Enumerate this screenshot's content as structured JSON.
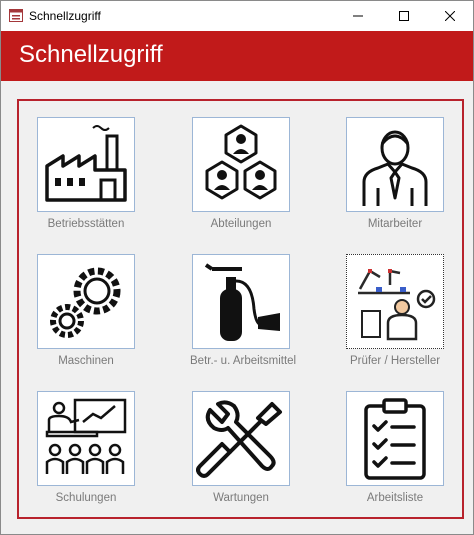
{
  "window": {
    "title": "Schnellzugriff"
  },
  "header": {
    "title": "Schnellzugriff"
  },
  "tiles": [
    {
      "label": "Betriebsstätten",
      "icon": "factory-icon"
    },
    {
      "label": "Abteilungen",
      "icon": "departments-icon"
    },
    {
      "label": "Mitarbeiter",
      "icon": "employee-icon"
    },
    {
      "label": "Maschinen",
      "icon": "gears-icon"
    },
    {
      "label": "Betr.- u. Arbeitsmittel",
      "icon": "fire-extinguisher-icon"
    },
    {
      "label": "Prüfer / Hersteller",
      "icon": "inspector-icon"
    },
    {
      "label": "Schulungen",
      "icon": "training-icon"
    },
    {
      "label": "Wartungen",
      "icon": "tools-icon"
    },
    {
      "label": "Arbeitsliste",
      "icon": "checklist-icon"
    }
  ],
  "colors": {
    "header_bg": "#c11a1a",
    "panel_border": "#b8222c",
    "label_text": "#7a7a7a"
  }
}
